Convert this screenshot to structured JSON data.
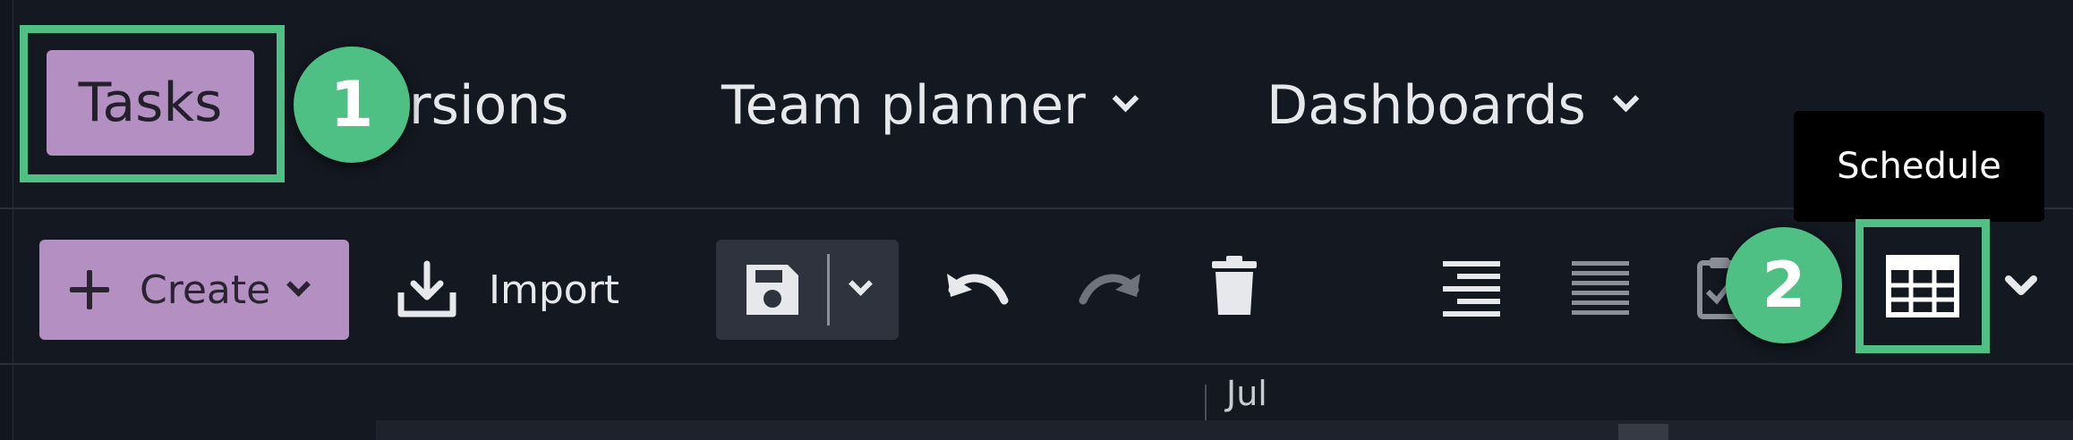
{
  "nav": {
    "tasks": "Tasks",
    "versions": "ersions",
    "team_planner": "Team planner",
    "dashboards": "Dashboards"
  },
  "toolbar": {
    "create_label": "Create",
    "import_label": "Import",
    "icons": [
      "plus-icon",
      "chevron-down-icon",
      "import-icon",
      "save-icon",
      "undo-icon",
      "redo-icon",
      "trash-icon",
      "align-right-icon",
      "align-justify-icon",
      "clipboard-check-icon",
      "table-icon"
    ]
  },
  "annotations": {
    "badge_1": "1",
    "badge_2": "2"
  },
  "tooltip": {
    "text": "Schedule"
  },
  "timeline": {
    "month": "Jul"
  },
  "colors": {
    "background": "#141821",
    "accent_purple": "#b48fc2",
    "highlight_green": "#4fc084",
    "text": "#e6e8eb"
  }
}
